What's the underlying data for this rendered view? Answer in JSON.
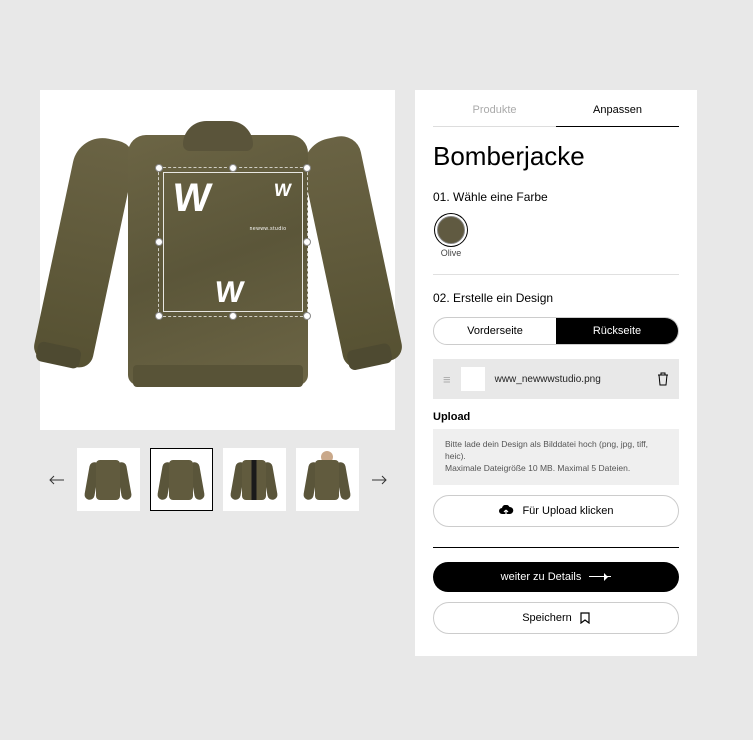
{
  "tabs": {
    "products": "Produkte",
    "customize": "Anpassen"
  },
  "product": {
    "title": "Bomberjacke"
  },
  "step1": {
    "label": "01.  Wähle eine Farbe",
    "colors": [
      {
        "name": "Olive",
        "hex": "#605a41"
      }
    ]
  },
  "step2": {
    "label": "02.  Erstelle ein Design",
    "front": "Vorderseite",
    "back": "Rückseite",
    "file": {
      "name": "www_newwwstudio.png"
    }
  },
  "upload": {
    "heading": "Upload",
    "note_line1": "Bitte lade dein Design als Bilddatei hoch (png, jpg, tiff, heic).",
    "note_line2": "Maximale Dateigröße 10 MB. Maximal 5 Dateien.",
    "button": "Für Upload klicken"
  },
  "actions": {
    "continue": "weiter zu Details",
    "save": "Speichern"
  },
  "design_overlay": {
    "brand_text": "newww.studio"
  }
}
